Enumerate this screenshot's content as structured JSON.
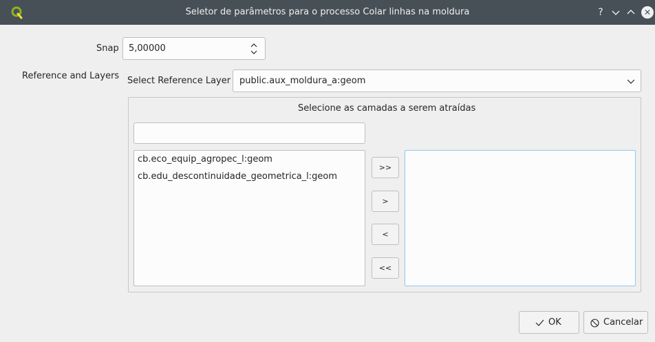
{
  "window": {
    "title": "Seletor de parâmetros para o processo Colar linhas na moldura",
    "app_icon": "qgis-logo-icon",
    "controls": [
      "help-icon",
      "minimize-icon",
      "maximize-icon",
      "close-icon"
    ]
  },
  "form": {
    "snap_label": "Snap",
    "snap_value": "5,00000",
    "reference_layers_label": "Reference and  Layers",
    "select_reference_label": "Select Reference Layer",
    "reference_layer_value": "public.aux_moldura_a:geom",
    "group_title": "Selecione as camadas a serem atraídas",
    "filter_value": "",
    "available_layers": [
      "cb.eco_equip_agropec_l:geom",
      "cb.edu_descontinuidade_geometrica_l:geom"
    ],
    "selected_layers": [],
    "move_buttons": {
      "add_all": ">>",
      "add_one": ">",
      "remove_one": "<",
      "remove_all": "<<"
    }
  },
  "buttons": {
    "ok_label": "OK",
    "cancel_label": "Cancelar"
  },
  "colors": {
    "titlebar": "#475057",
    "focus_border": "#8ec6ee",
    "window_bg": "#efefef"
  }
}
